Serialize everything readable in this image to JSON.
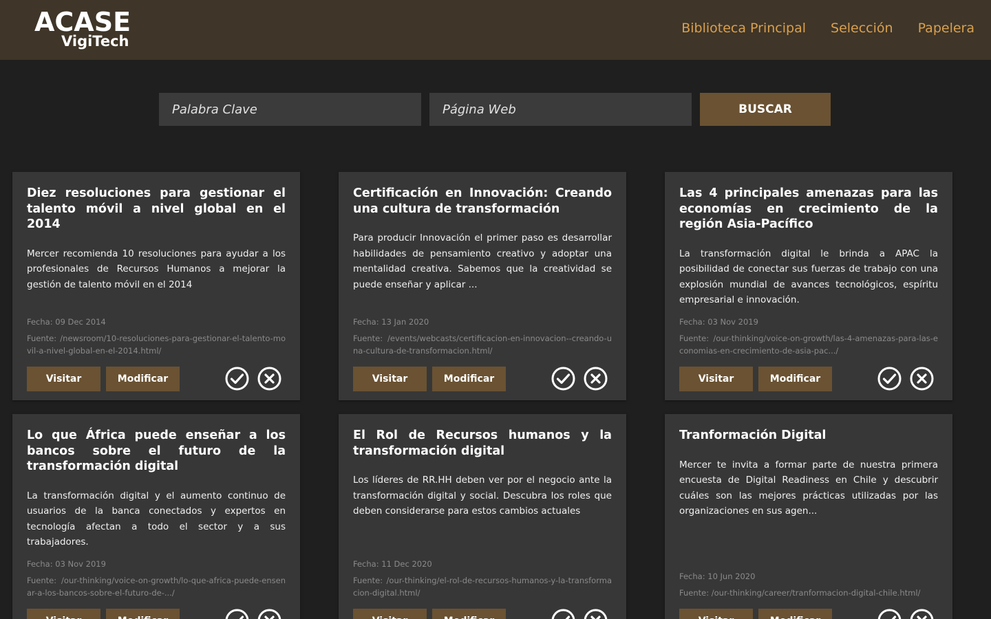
{
  "header": {
    "logo_main": "ACASE",
    "logo_sub": "VigiTech",
    "nav": [
      "Biblioteca Principal",
      "Selección",
      "Papelera"
    ]
  },
  "search": {
    "keyword_placeholder": "Palabra Clave",
    "web_placeholder": "Página Web",
    "button_label": "BUSCAR"
  },
  "actions": {
    "visit_label": "Visitar",
    "edit_label": "Modificar"
  },
  "colors": {
    "header_bg": "#3f3528",
    "accent": "#d9a04f",
    "button": "#6a5232",
    "card_bg": "#373737",
    "page_bg": "#1f1f1f"
  },
  "icons": {
    "approve": "check-circle-icon",
    "reject": "x-circle-icon"
  },
  "cards": [
    {
      "title": "Diez resoluciones para gestionar el talento móvil a nivel global en el 2014",
      "description": "Mercer recomienda 10 resoluciones para ayudar a los profesionales de Recursos Humanos a mejorar la gestión de talento móvil en el 2014",
      "date": "Fecha: 09 Dec 2014",
      "source": "Fuente: /newsroom/10-resoluciones-para-gestionar-el-talento-movil-a-nivel-global-en-el-2014.html/"
    },
    {
      "title": "Certificación en Innovación: Creando una cultura de transformación",
      "description": "Para producir Innovación el primer paso es desarrollar habilidades de pensamiento creativo y adoptar una mentalidad creativa. Sabemos que la creatividad se puede enseñar y aplicar ...",
      "date": "Fecha: 13 Jan 2020",
      "source": "Fuente: /events/webcasts/certificacion-en-innovacion--creando-una-cultura-de-transformacion.html/"
    },
    {
      "title": "Las 4 principales amenazas para las economías en crecimiento de la región Asia-Pacífico",
      "description": "La transformación digital le brinda a APAC la posibilidad de conectar sus fuerzas de trabajo con una explosión mundial de avances tecnológicos, espíritu empresarial e innovación.",
      "date": "Fecha: 03 Nov 2019",
      "source": "Fuente: /our-thinking/voice-on-growth/las-4-amenazas-para-las-economias-en-crecimiento-de-asia-pac.../"
    },
    {
      "title": "Lo que África puede enseñar a los bancos sobre el futuro de la transformación digital",
      "description": "La transformación digital y el aumento continuo de usuarios de la banca conectados y expertos en tecnología afectan a todo el sector y a sus trabajadores.",
      "date": "Fecha: 03 Nov 2019",
      "source": "Fuente: /our-thinking/voice-on-growth/lo-que-africa-puede-ensenar-a-los-bancos-sobre-el-futuro-de-.../"
    },
    {
      "title": "El Rol de Recursos humanos y la transformación digital",
      "description": "Los líderes de RR.HH deben ver por el negocio ante la transformación digital y social. Descubra los roles que deben considerarse para estos cambios actuales",
      "date": "Fecha: 11 Dec 2020",
      "source": "Fuente: /our-thinking/el-rol-de-recursos-humanos-y-la-transformacion-digital.html/"
    },
    {
      "title": "Tranformación Digital",
      "description": "Mercer te invita a formar parte de nuestra primera encuesta de Digital Readiness en Chile y descubrir cuáles son las mejores prácticas utilizadas por las organizaciones en sus agen...",
      "date": "Fecha: 10 Jun 2020",
      "source": "Fuente: /our-thinking/career/tranformacion-digital-chile.html/"
    }
  ]
}
